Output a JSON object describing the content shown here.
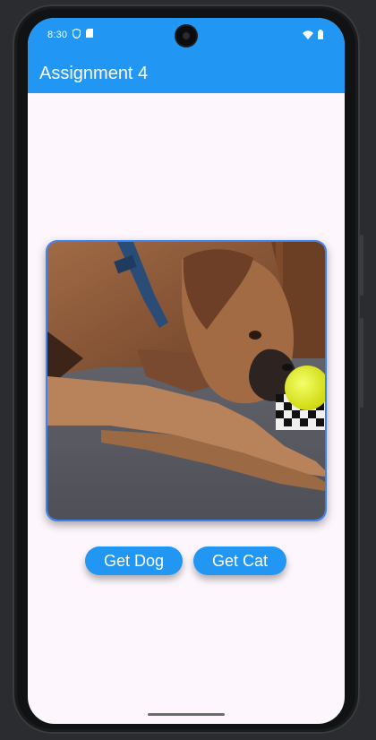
{
  "status_bar": {
    "time": "8:30",
    "icons_left": [
      "shield-icon",
      "sim-card-icon"
    ],
    "icons_right": [
      "wifi-icon",
      "battery-icon"
    ]
  },
  "app_bar": {
    "title": "Assignment 4",
    "color": "#2196f3"
  },
  "main": {
    "image": {
      "subject": "boxer dog chewing yellow ball toy"
    },
    "buttons": [
      {
        "label": "Get Dog"
      },
      {
        "label": "Get Cat"
      }
    ]
  },
  "colors": {
    "primary": "#2196f3",
    "background": "#fdf7fd",
    "image_border": "#3d82f0"
  }
}
